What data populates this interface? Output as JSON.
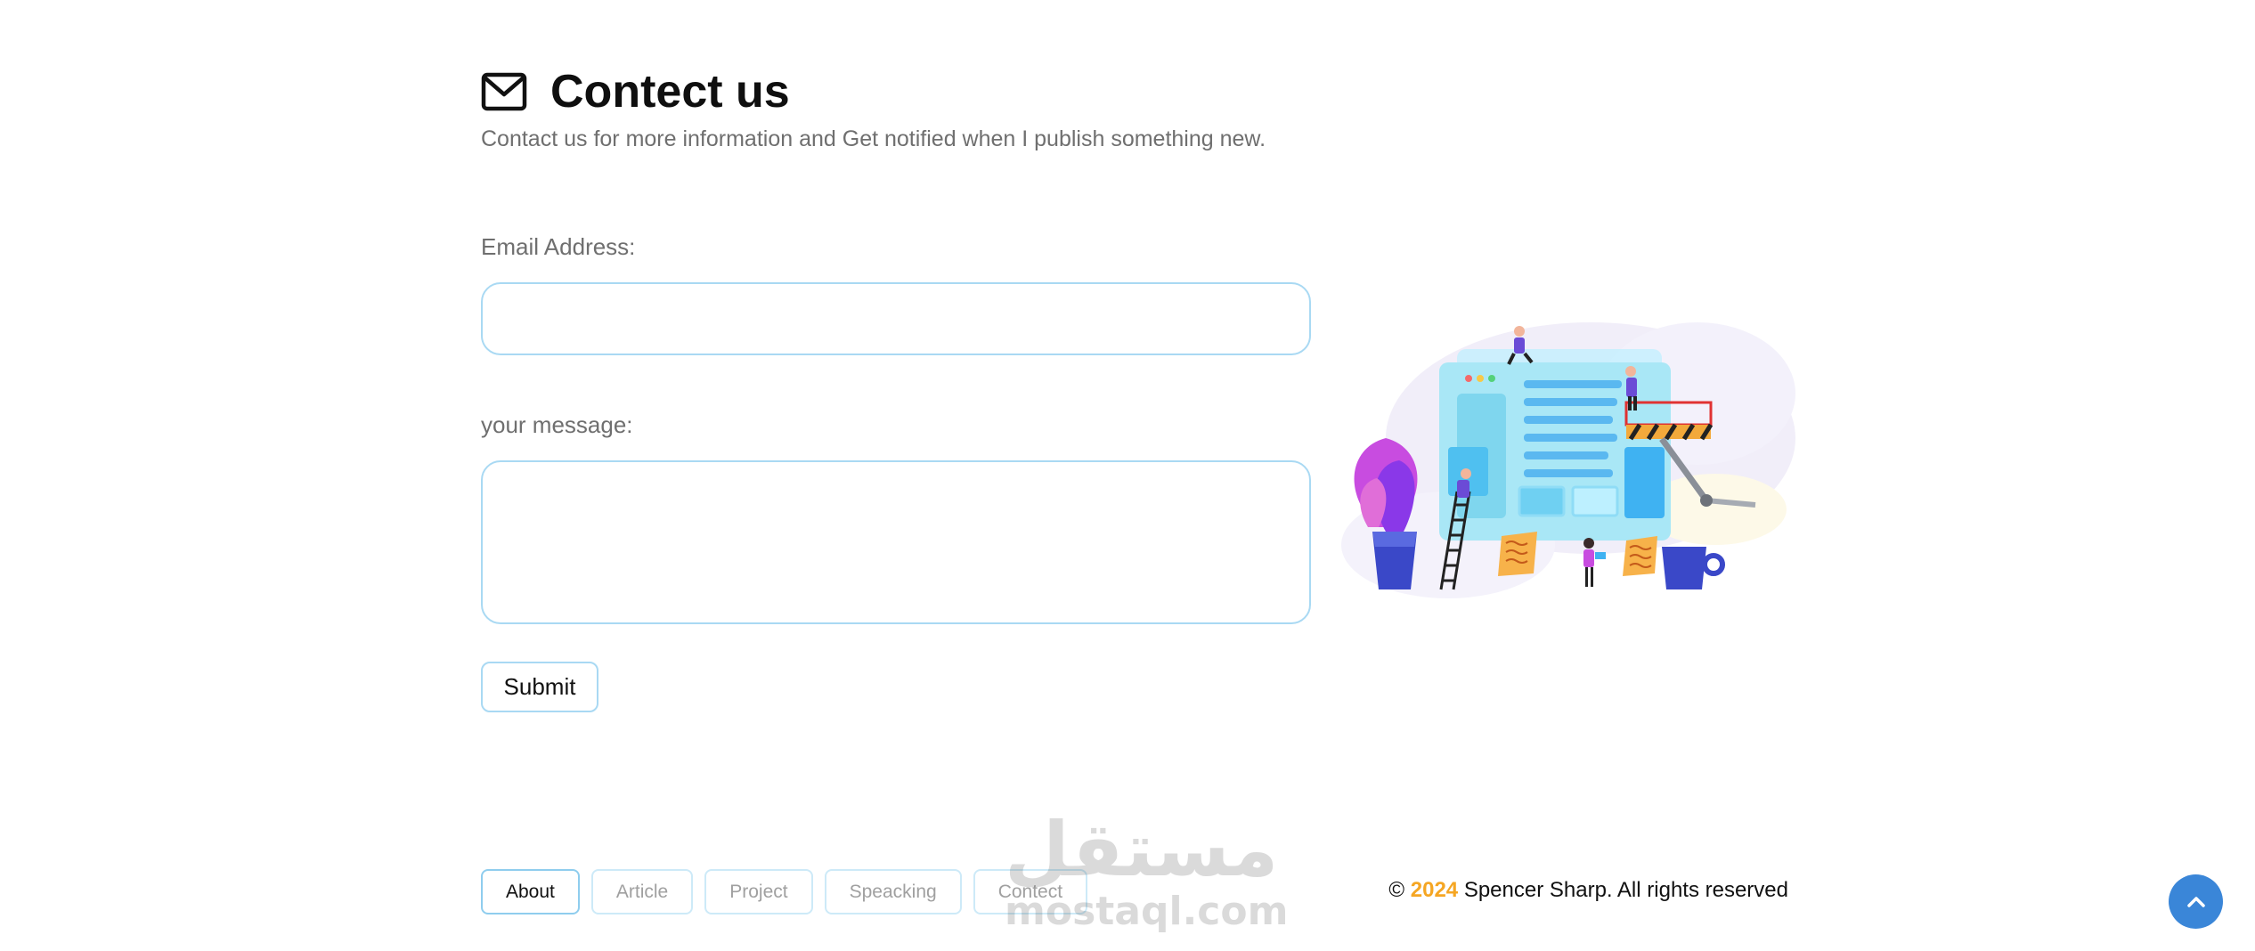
{
  "header": {
    "icon": "envelope-icon",
    "title": "Contect us",
    "subtitle": "Contact us for more information and Get notified when I publish something new."
  },
  "form": {
    "email_label": "Email Address:",
    "email_value": "",
    "message_label": "your message:",
    "message_value": "",
    "submit_label": "Submit"
  },
  "footer": {
    "nav": [
      {
        "label": "About",
        "active": true
      },
      {
        "label": "Article",
        "active": false
      },
      {
        "label": "Project",
        "active": false
      },
      {
        "label": "Speacking",
        "active": false
      },
      {
        "label": "Contect",
        "active": false
      }
    ],
    "copyright_symbol": "©",
    "copyright_year": "2024",
    "copyright_text": "Spencer Sharp. All rights reserved"
  },
  "watermark": {
    "arabic": "مستقل",
    "latin": "mostaql.com"
  },
  "scroll_top": {
    "icon": "chevron-up-icon"
  },
  "colors": {
    "accent_border": "#a9d9f3",
    "year": "#f5a623",
    "scroll_button": "#3a86d8"
  }
}
